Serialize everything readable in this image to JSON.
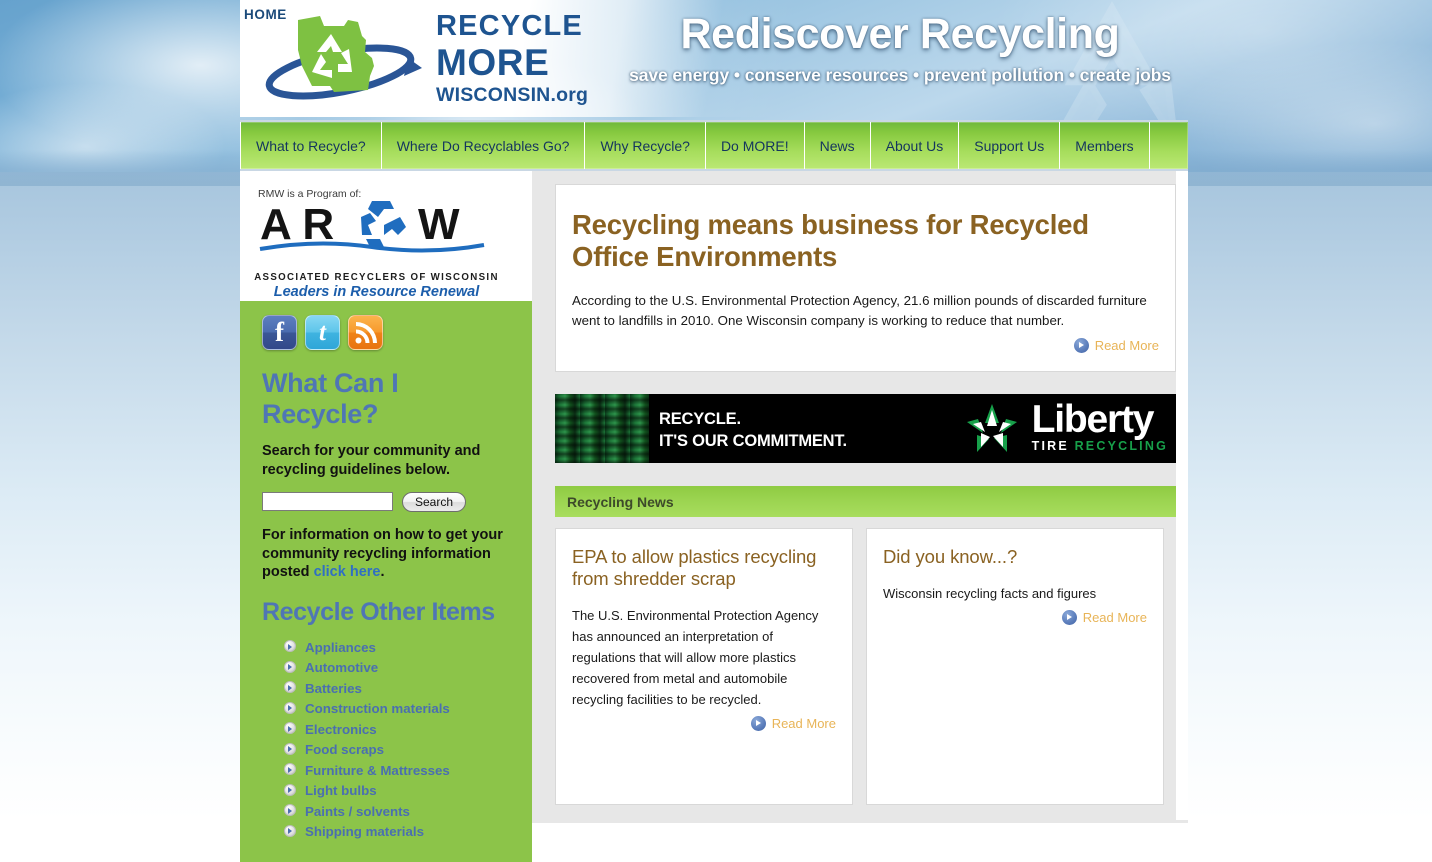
{
  "header": {
    "home_label": "HOME",
    "logo": {
      "line1": "RECYCLE",
      "line2": "MORE",
      "line3": "WISCONSIN.org"
    },
    "tagline_main": "Rediscover Recycling",
    "tagline_sub": "save energy • conserve resources • prevent pollution • create jobs"
  },
  "nav": {
    "items": [
      {
        "label": "What to Recycle?"
      },
      {
        "label": "Where Do Recyclables Go?"
      },
      {
        "label": "Why Recycle?"
      },
      {
        "label": "Do MORE!"
      },
      {
        "label": "News"
      },
      {
        "label": "About Us"
      },
      {
        "label": "Support Us"
      },
      {
        "label": "Members"
      }
    ]
  },
  "sidebar": {
    "arow": {
      "program_of": "RMW is a Program of:",
      "acronym": "AROW",
      "full_name": "ASSOCIATED RECYCLERS OF WISCONSIN",
      "slogan": "Leaders in Resource Renewal"
    },
    "social": [
      {
        "name": "facebook",
        "glyph": "f"
      },
      {
        "name": "twitter",
        "glyph": "t"
      },
      {
        "name": "rss",
        "glyph": ""
      }
    ],
    "what_can_i_recycle_heading": "What Can I Recycle?",
    "search_prompt": "Search for your community and recycling guidelines below.",
    "search_value": "",
    "search_placeholder": "",
    "search_button_label": "Search",
    "info_text_before": "For information on how to get your community recycling information posted ",
    "info_link_label": "click here",
    "info_text_after": ".",
    "recycle_other_heading": "Recycle Other Items",
    "items": [
      "Appliances",
      "Automotive",
      "Batteries",
      "Construction materials",
      "Electronics",
      "Food scraps",
      "Furniture & Mattresses",
      "Light bulbs",
      "Paints / solvents",
      "Shipping materials"
    ]
  },
  "main": {
    "feature": {
      "title": "Recycling means business for Recycled Office Environments",
      "body": "According to the U.S. Environmental Protection Agency, 21.6 million pounds of discarded furniture went to landfills in 2010. One Wisconsin company is working to reduce that number.",
      "read_more_label": "Read More"
    },
    "banner": {
      "line1": "RECYCLE.",
      "line2": "IT'S OUR COMMITMENT.",
      "brand": "Liberty",
      "brand_sub_1": "TIRE",
      "brand_sub_2": "RECYCLING"
    },
    "news_header": "Recycling News",
    "news_cards": [
      {
        "title": "EPA to allow plastics recycling from shredder scrap",
        "body": "The U.S. Environmental Protection Agency has announced an interpretation of regulations that will allow more plastics recovered from metal and automobile recycling facilities to be recycled.",
        "read_more_label": "Read More"
      },
      {
        "title": "Did you know...?",
        "body": "Wisconsin recycling facts and figures",
        "read_more_label": "Read More"
      }
    ]
  },
  "colors": {
    "nav_green": "#8cc93f",
    "panel_green": "#8cc449",
    "heading_blue": "#4f76b5",
    "title_brown": "#8a6222",
    "readmore_gold": "#e8b457",
    "logo_blue": "#1e5490",
    "liberty_green": "#17a04a"
  }
}
